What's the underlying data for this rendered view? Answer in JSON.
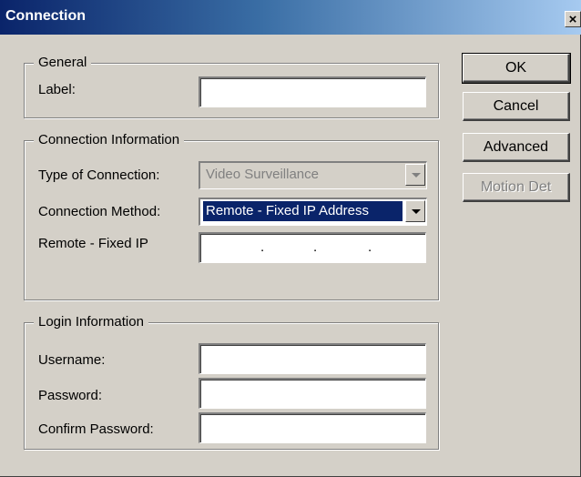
{
  "window": {
    "title": "Connection",
    "close_label": "×"
  },
  "general": {
    "legend": "General",
    "label_caption": "Label:",
    "label_value": ""
  },
  "connection_info": {
    "legend": "Connection Information",
    "type_caption": "Type of Connection:",
    "type_value": "Video Surveillance",
    "method_caption": "Connection Method:",
    "method_value": "Remote - Fixed IP Address",
    "ip_caption": "Remote - Fixed IP",
    "ip_dots": ".",
    "ip_octets": [
      "",
      "",
      "",
      ""
    ]
  },
  "login_info": {
    "legend": "Login Information",
    "username_caption": "Username:",
    "password_caption": "Password:",
    "confirm_caption": "Confirm Password:",
    "username_value": "",
    "password_value": "",
    "confirm_value": ""
  },
  "buttons": {
    "ok": "OK",
    "cancel": "Cancel",
    "advanced": "Advanced",
    "motion_det": "Motion Det"
  },
  "colors": {
    "titlebar_start": "#0a246a",
    "titlebar_end": "#a6caf0",
    "dialog_face": "#d4d0c8",
    "selection": "#0a246a"
  }
}
